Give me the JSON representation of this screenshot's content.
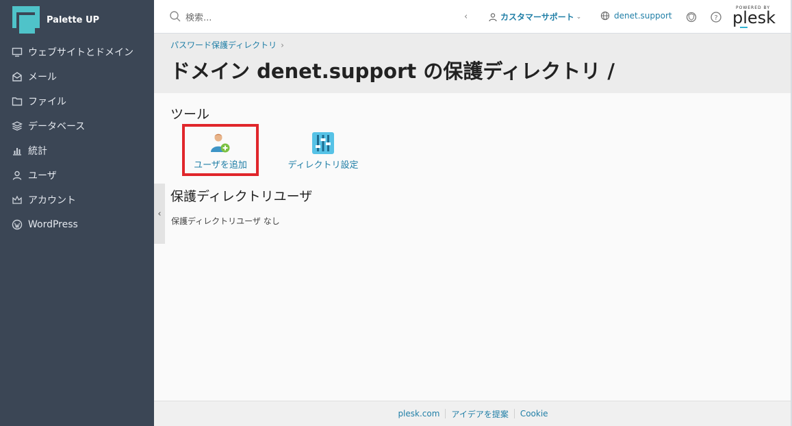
{
  "brand": {
    "name": "Palette UP"
  },
  "sidebar": {
    "items": [
      {
        "label": "ウェブサイトとドメイン",
        "icon": "monitor-icon"
      },
      {
        "label": "メール",
        "icon": "mail-icon"
      },
      {
        "label": "ファイル",
        "icon": "folder-icon"
      },
      {
        "label": "データベース",
        "icon": "database-icon"
      },
      {
        "label": "統計",
        "icon": "bar-chart-icon"
      },
      {
        "label": "ユーザ",
        "icon": "user-icon"
      },
      {
        "label": "アカウント",
        "icon": "crown-icon"
      },
      {
        "label": "WordPress",
        "icon": "wordpress-icon"
      }
    ]
  },
  "topbar": {
    "search_placeholder": "検索...",
    "user_label": "カスタマーサポート",
    "domain_label": "denet.support",
    "brand_powered": "POWERED BY",
    "brand_word": "plesk"
  },
  "header": {
    "breadcrumb": "パスワード保護ディレクトリ",
    "title": "ドメイン denet.support の保護ディレクトリ /"
  },
  "main": {
    "tools_title": "ツール",
    "tools": [
      {
        "label": "ユーザを追加",
        "icon": "add-user-icon"
      },
      {
        "label": "ディレクトリ設定",
        "icon": "directory-settings-icon"
      }
    ],
    "users_title": "保護ディレクトリユーザ",
    "users_empty": "保護ディレクトリユーザ なし"
  },
  "footer": {
    "links": [
      "plesk.com",
      "アイデアを提案",
      "Cookie"
    ]
  },
  "colors": {
    "sidebar_bg": "#3b4655",
    "accent": "#4fc3c9",
    "link": "#1f7ea6",
    "highlight": "#e0262b"
  }
}
